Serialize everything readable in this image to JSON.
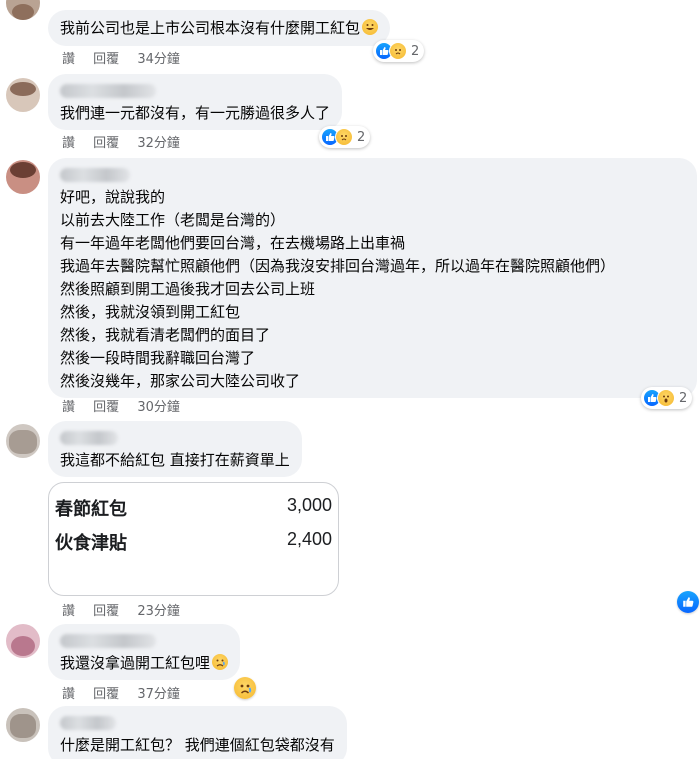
{
  "colors": {
    "bubble": "#f0f2f5",
    "like_blue": "#0866ff",
    "meta_text": "#65676b"
  },
  "action_labels": {
    "like": "讚",
    "reply": "回覆"
  },
  "comments": [
    {
      "lines": [
        "我前公司也是上市公司根本沒有什麼開工紅包"
      ],
      "trailing_emoji": "grinning-sweat-emoji",
      "time": "34分鐘",
      "reactions": {
        "icons": [
          "like-icon",
          "sad-icon"
        ],
        "count": "2"
      }
    },
    {
      "lines": [
        "我們連一元都沒有，有一元勝過很多人了"
      ],
      "time": "32分鐘",
      "reactions": {
        "icons": [
          "like-icon",
          "sad-icon"
        ],
        "count": "2"
      }
    },
    {
      "lines": [
        "好吧，說說我的",
        "以前去大陸工作（老闆是台灣的）",
        "有一年過年老闆他們要回台灣，在去機場路上出車禍",
        "我過年去醫院幫忙照顧他們（因為我沒安排回台灣過年，所以過年在醫院照顧他們）",
        "然後照顧到開工過後我才回去公司上班",
        "然後，我就沒領到開工紅包",
        "然後，我就看清老闆們的面目了",
        "然後一段時間我辭職回台灣了",
        "然後沒幾年，那家公司大陸公司收了"
      ],
      "time": "30分鐘",
      "reactions": {
        "icons": [
          "like-icon",
          "wow-icon"
        ],
        "count": "2"
      }
    },
    {
      "lines": [
        "我這都不給紅包 直接打在薪資單上"
      ],
      "time": "23分鐘",
      "attachment": {
        "rows": [
          {
            "label": "春節紅包",
            "amount": "3,000"
          },
          {
            "label": "伙食津貼",
            "amount": "2,400"
          }
        ]
      }
    },
    {
      "lines": [
        "我還沒拿過開工紅包哩"
      ],
      "trailing_emoji": "crying-emoji",
      "time": "37分鐘",
      "reactions": {
        "icons": [
          "sad-icon"
        ]
      }
    },
    {
      "lines": [
        "什麼是開工紅包？ 我們連個紅包袋都沒有"
      ]
    }
  ]
}
